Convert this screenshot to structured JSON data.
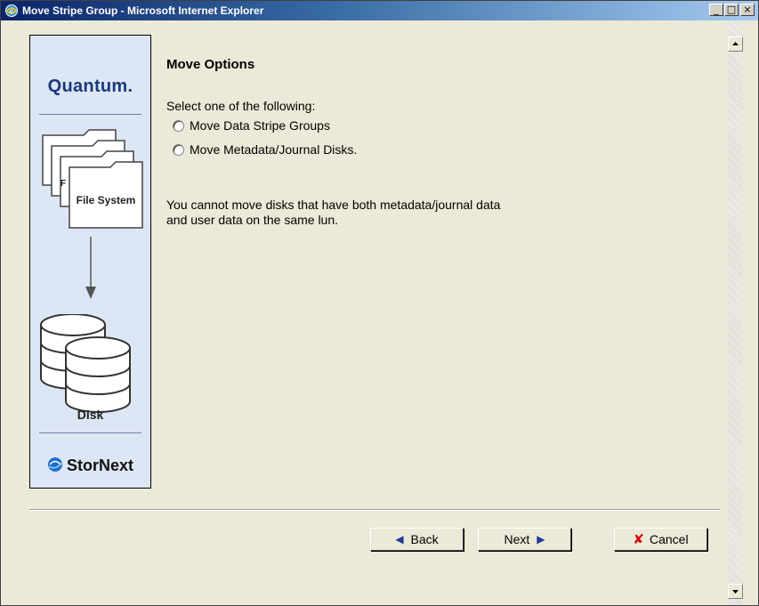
{
  "window": {
    "title": "Move Stripe Group - Microsoft Internet Explorer",
    "minimize_glyph": "_",
    "maximize_glyph": "□",
    "close_glyph": "×"
  },
  "side_panel": {
    "brand_logo": "Quantum.",
    "folder_label": "File System",
    "disk_label": "Disk",
    "product_logo": "StorNext"
  },
  "main": {
    "title": "Move Options",
    "prompt": "Select one of the following:",
    "options": [
      {
        "label": "Move Data Stripe Groups",
        "selected": false
      },
      {
        "label": "Move Metadata/Journal Disks.",
        "selected": false
      }
    ],
    "note_line1": "You cannot move disks that have both metadata/journal data",
    "note_line2": "and user data on the same lun."
  },
  "buttons": {
    "back": "Back",
    "next": "Next",
    "cancel": "Cancel"
  },
  "icons": {
    "back": "left-triangle-icon",
    "next": "right-triangle-icon",
    "cancel": "red-x-icon",
    "window": "ie-globe-icon"
  }
}
